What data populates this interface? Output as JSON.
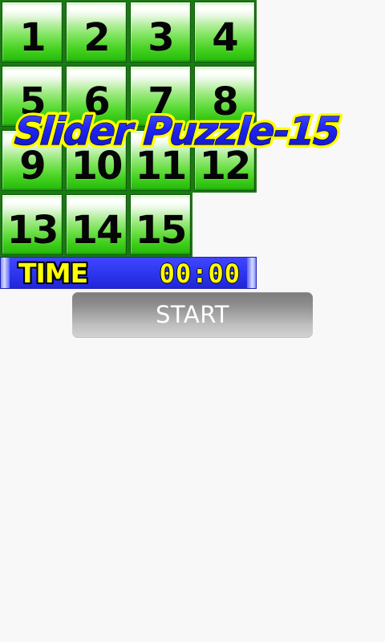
{
  "game": {
    "logo_text": "Slider Puzzle-15",
    "tiles": [
      "1",
      "2",
      "3",
      "4",
      "5",
      "6",
      "7",
      "8",
      "9",
      "10",
      "11",
      "12",
      "13",
      "14",
      "15",
      ""
    ],
    "time_label": "TIME",
    "time_value": "00:00",
    "start_label": "START"
  },
  "colors": {
    "background": "#f8f8f8",
    "tile_green": "#43d01e",
    "tile_border": "#1a7a12",
    "time_bar_blue": "#2e36ef",
    "time_text_yellow": "#ffff00",
    "logo_blue": "#1617e8",
    "logo_outline_yellow": "#ffff00",
    "start_button_gray": "#9b9b9b"
  }
}
